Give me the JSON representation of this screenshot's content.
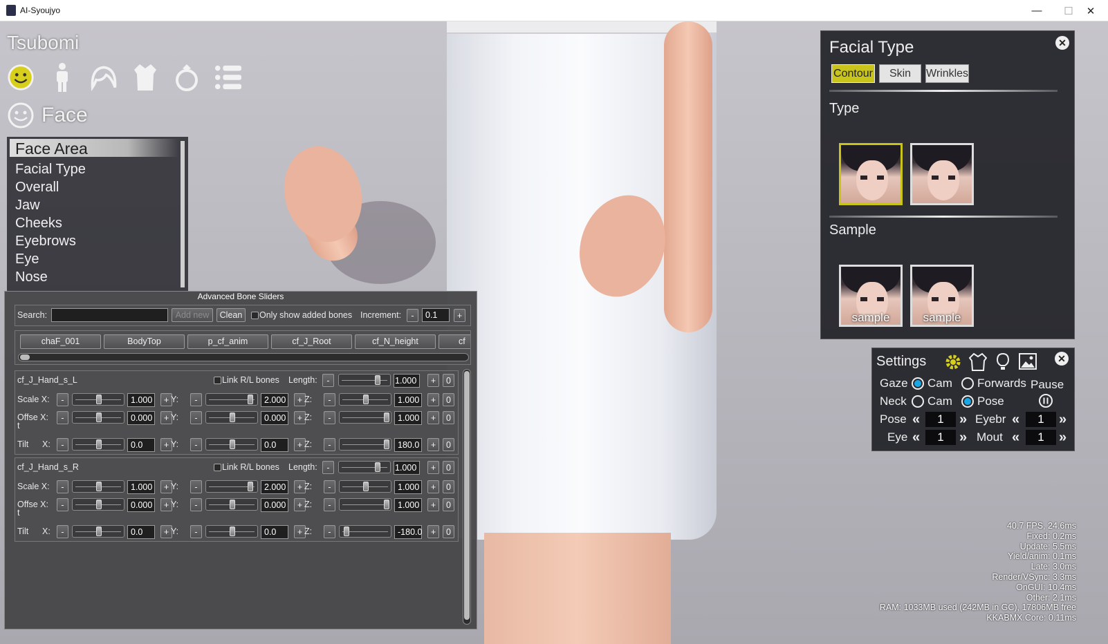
{
  "window": {
    "title": "AI-Syoujyo",
    "minimize": "—",
    "maximize": "☐",
    "close": "✕"
  },
  "character_name": "Tsubomi",
  "top_icons": [
    "face-icon",
    "body-icon",
    "hair-icon",
    "clothing-icon",
    "accessory-icon",
    "menu-list-icon"
  ],
  "category": {
    "label": "Face",
    "icon": "face-icon"
  },
  "face_menu": {
    "selected": "Face Area",
    "items": [
      "Facial Type",
      "Overall",
      "Jaw",
      "Cheeks",
      "Eyebrows",
      "Eye",
      "Nose"
    ]
  },
  "abs": {
    "title": "Advanced Bone Sliders",
    "search_label": "Search:",
    "search_value": "",
    "add_new": "Add new",
    "clean": "Clean",
    "only_added": "Only show added bones",
    "increment_label": "Increment:",
    "minus": "-",
    "plus": "+",
    "increment_value": "0.1",
    "bone_tabs": [
      "chaF_001",
      "BodyTop",
      "p_cf_anim",
      "cf_J_Root",
      "cf_N_height",
      "cf"
    ],
    "labels": {
      "link": "Link R/L bones",
      "length": "Length:",
      "scale": "Scale X:",
      "offset": "Offse X:",
      "offset_t": "t",
      "tilt": "Tilt",
      "x": "X:",
      "y": "Y:",
      "z": "Z:",
      "zero": "0"
    },
    "bones": [
      {
        "name": "cf_J_Hand_s_L",
        "length": "1.000",
        "scale": [
          "1.000",
          "2.000",
          "1.000"
        ],
        "offset": [
          "0.000",
          "0.000",
          "1.000"
        ],
        "tilt": [
          "0.0",
          "0.0",
          "180.0"
        ]
      },
      {
        "name": "cf_J_Hand_s_R",
        "length": "1.000",
        "scale": [
          "1.000",
          "2.000",
          "1.000"
        ],
        "offset": [
          "0.000",
          "0.000",
          "1.000"
        ],
        "tilt": [
          "0.0",
          "0.0",
          "-180.0"
        ]
      }
    ]
  },
  "facial_type": {
    "title": "Facial Type",
    "tabs": [
      "Contour",
      "Skin",
      "Wrinkles"
    ],
    "active_tab": "Contour",
    "type_label": "Type",
    "sample_label": "Sample",
    "sample_caption": "sample",
    "accent": "#c9c41c"
  },
  "settings": {
    "title": "Settings",
    "gaze": "Gaze",
    "neck": "Neck",
    "cam": "Cam",
    "forwards": "Forwards",
    "pose": "Pose",
    "pause": "Pause",
    "pose_label": "Pose",
    "eyebr_label": "Eyebr",
    "eye_label": "Eye",
    "mout_label": "Mout",
    "pose_value": "1",
    "eyebr_value": "1",
    "eye_value": "1",
    "mout_value": "1",
    "radio_color": "#1aa7e6"
  },
  "stats": [
    "40.7 FPS,  24.6ms",
    "Fixed:  0.2ms",
    "Update:  5.5ms",
    "Yield/anim:  0.1ms",
    "Late:  3.0ms",
    "Render/VSync:  3.3ms",
    "OnGUI:  10.4ms",
    "Other:  2.1ms",
    "RAM: 1033MB used (242MB in GC), 17806MB free",
    "KKABMX.Core: 0.11ms"
  ]
}
